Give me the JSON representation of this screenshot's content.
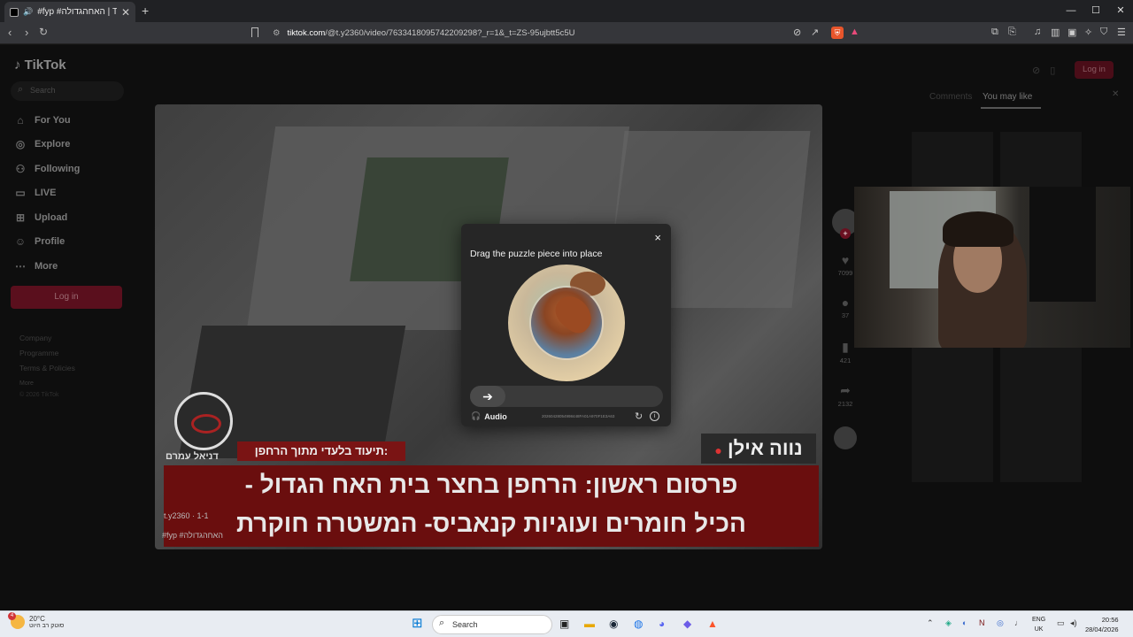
{
  "browser": {
    "tab_title": "#fyp #האחהגדולה | TikTok",
    "new_tab": "+",
    "url_domain": "tiktok.com",
    "url_path": "/@t.y2360/video/7633418095742209298?_r=1&_t=ZS-95ujbtt5c5U",
    "window_controls": [
      "—",
      "☐",
      "✕"
    ]
  },
  "tiktok": {
    "logo": "TikTok",
    "search_placeholder": "Search",
    "nav": [
      {
        "label": "For You",
        "icon": "home-icon"
      },
      {
        "label": "Explore",
        "icon": "compass-icon"
      },
      {
        "label": "Following",
        "icon": "person-icon"
      },
      {
        "label": "LIVE",
        "icon": "live-icon"
      },
      {
        "label": "Upload",
        "icon": "plus-square-icon"
      },
      {
        "label": "Profile",
        "icon": "profile-icon"
      },
      {
        "label": "More",
        "icon": "more-icon"
      }
    ],
    "login": "Log in",
    "footer": [
      "Company",
      "Programme",
      "Terms & Policies",
      "More"
    ],
    "copyright": "© 2026 TikTok",
    "top_login": "Log in",
    "right_tabs": {
      "comments": "Comments",
      "you_may_like": "You may like"
    }
  },
  "video": {
    "badge_text": "דניאל עמרם",
    "sub_banner": "תיעוד בלעדי מתוך הרחפן:",
    "name_banner": "נווה אילן",
    "main_banner_line1": "פרסום ראשון: הרחפן בחצר בית האח הגדול -",
    "main_banner_line2": "הכיל חומרים ועוגיות קנאביס- המשטרה חוקרת",
    "username": "t.y2360 · 1-1",
    "hashtags": "#fyp #האחהגדולה"
  },
  "actions": {
    "likes": "7099",
    "comments": "37",
    "saves": "421",
    "shares": "2132"
  },
  "captcha": {
    "title": "Drag the puzzle piece into place",
    "audio": "Audio",
    "id": "20260428054998448FA01A970F1E3A63",
    "close": "×"
  },
  "taskbar": {
    "temp": "20°C",
    "weather_desc": "סוטק רב היוט",
    "weather_badge": "4",
    "search": "Search",
    "lang_1": "ENG",
    "lang_2": "UK",
    "time": "20:56",
    "date": "28/04/2026"
  }
}
